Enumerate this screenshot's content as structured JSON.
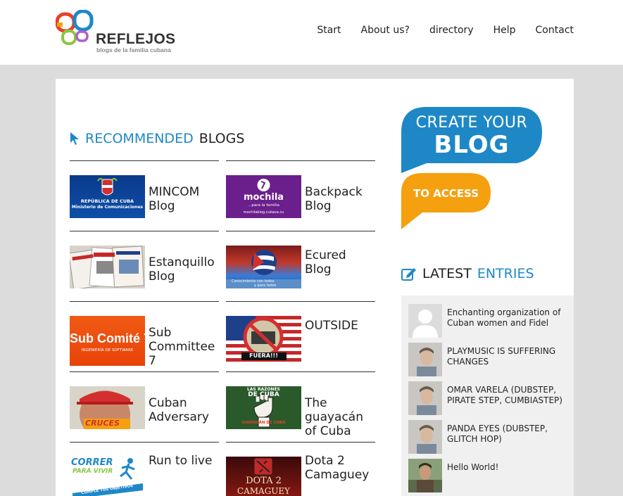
{
  "header": {
    "logo_text": "REFLEJOS",
    "logo_tagline": "blogs de la familia cubana",
    "nav": [
      "Start",
      "About us?",
      "directory",
      "Help",
      "Contact"
    ]
  },
  "recommended": {
    "title_blue": "RECOMMENDED",
    "title_dark": "BLOGS",
    "blogs": [
      {
        "name": "MINCOM Blog",
        "thumb_text": [
          "REPÚBLICA DE CUBA",
          "Ministerio de Comunicaciones"
        ]
      },
      {
        "name": "Backpack Blog",
        "thumb_text": [
          "mochila",
          "...para la familia",
          "mochilablog.cubava.cu"
        ]
      },
      {
        "name": "Estanquillo Blog"
      },
      {
        "name": "Ecured Blog",
        "thumb_text": [
          "Conocimiento con todos",
          "y para todos"
        ]
      },
      {
        "name": "Sub Committee 7",
        "thumb_text": [
          "Sub Comité 7",
          "INGENIERÍA DE SOFTWARE"
        ]
      },
      {
        "name": "OUTSIDE",
        "thumb_text": [
          "FUERA!!!"
        ]
      },
      {
        "name": "Cuban Adversary",
        "thumb_text": [
          "CRUCES"
        ]
      },
      {
        "name": "The guayacán of Cuba",
        "thumb_text": [
          "LAS RAZONES",
          "DE CUBA",
          "GUAYACÁN DE CUBA"
        ]
      },
      {
        "name": "Run to live",
        "thumb_text": [
          "CORRER",
          "PARA VIVIR",
          "CUMPLE TUS OBJETIVOS"
        ]
      },
      {
        "name": "Dota 2 Camaguey",
        "thumb_text": [
          "DOTA 2",
          "CAMAGUEY"
        ]
      }
    ]
  },
  "create": {
    "line1": "CREATE YOUR",
    "line2": "BLOG",
    "access": "TO ACCESS"
  },
  "latest": {
    "title_dark": "LATEST",
    "title_blue": "ENTRIES",
    "entries": [
      {
        "title": "Enchanting organization of Cuban women and Fidel"
      },
      {
        "title": "PLAYMUSIC IS SUFFERING CHANGES"
      },
      {
        "title": "OMAR VARELA (DUBSTEP, PIRATE STEP, CUMBIASTEP)"
      },
      {
        "title": "PANDA EYES (DUBSTEP, GLITCH HOP)"
      },
      {
        "title": "Hello World!"
      }
    ]
  },
  "colors": {
    "accent_blue": "#1e88c7",
    "accent_orange": "#f5a00f"
  }
}
